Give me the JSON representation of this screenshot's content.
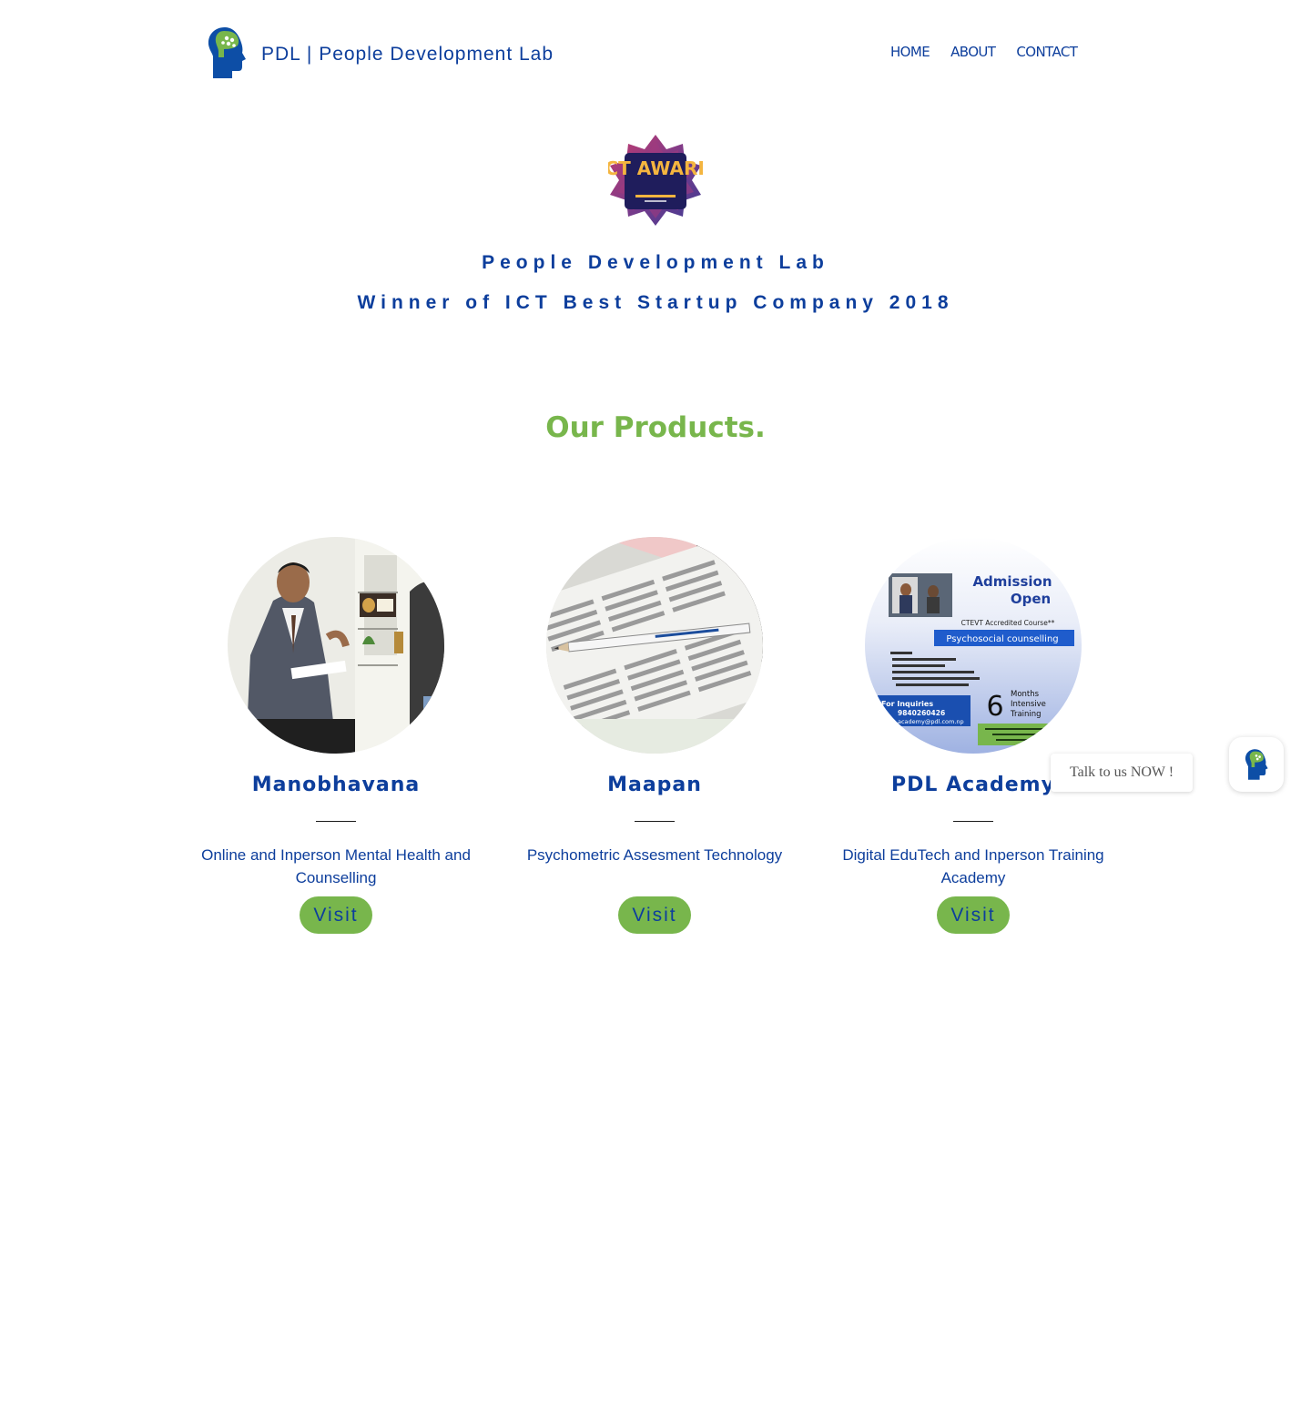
{
  "header": {
    "title": "PDL | People Development Lab",
    "logo_icon": "head-brain-logo-icon",
    "nav": [
      {
        "label": "HOME"
      },
      {
        "label": "ABOUT"
      },
      {
        "label": "CONTACT"
      }
    ]
  },
  "hero": {
    "award_badge_text": "ICT AWARD",
    "line1": "People Development Lab",
    "line2": "Winner of ICT Best Startup Company 2018"
  },
  "products": {
    "heading": "Our Products.",
    "items": [
      {
        "title": "Manobhavana",
        "description": "Online and Inperson Mental Health and Counselling",
        "button": "Visit",
        "image": "counselling-session-photo"
      },
      {
        "title": "Maapan",
        "description": "Psychometric Assesment Technology",
        "button": "Visit",
        "image": "answer-sheet-pencil-photo"
      },
      {
        "title": "PDL Academy",
        "description": "Digital EduTech and Inperson Training Academy",
        "button": "Visit",
        "image": "admission-open-flyer",
        "flyer": {
          "title_1": "Admission",
          "title_2": "Open",
          "course": "CTEVT Accredited Course**",
          "banner": "Psychosocial counselling",
          "big_number": "6",
          "months": "Months",
          "intensive": "Intensive",
          "training": "Training",
          "inquiries": "For Inquiries",
          "phone": "9840260426",
          "email": "academy@pdl.com.np"
        }
      }
    ]
  },
  "chat": {
    "bubble": "Talk to us NOW !",
    "icon": "head-brain-logo-icon"
  },
  "colors": {
    "brand_blue": "#0d3e9c",
    "brand_green": "#78b64c"
  }
}
